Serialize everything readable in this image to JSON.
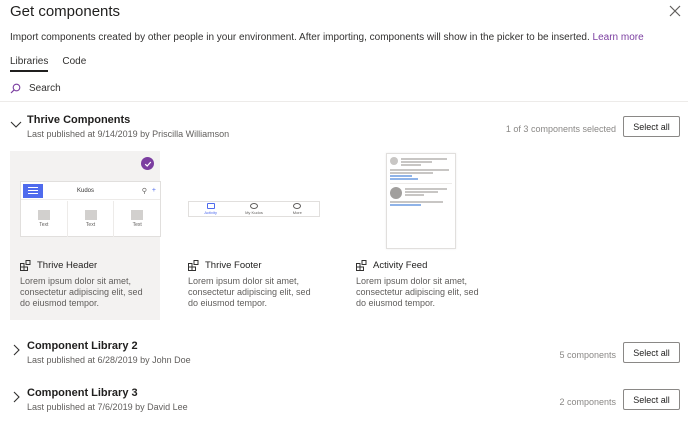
{
  "dialog": {
    "title": "Get components",
    "subtitle": "Import components created by other people in your environment. After importing, components will show in the picker to be inserted.",
    "learn_more": "Learn more",
    "close_icon": "close-icon"
  },
  "tabs": [
    {
      "label": "Libraries",
      "active": true
    },
    {
      "label": "Code",
      "active": false
    }
  ],
  "search": {
    "placeholder": "Search",
    "icon": "search-icon"
  },
  "libraries": [
    {
      "name": "Thrive Components",
      "meta": "Last published at 9/14/2019 by Priscilla Williamson",
      "count": "1 of 3 components selected",
      "select_all": "Select all",
      "expanded": true,
      "components": [
        {
          "name": "Thrive Header",
          "description": "Lorem ipsum dolor sit amet, consectetur adipiscing elit, sed do eiusmod tempor.",
          "selected": true,
          "preview": {
            "title": "Kudos",
            "tiles": [
              "Text",
              "Text",
              "Text"
            ]
          }
        },
        {
          "name": "Thrive Footer",
          "description": "Lorem ipsum dolor sit amet, consectetur adipiscing elit, sed do eiusmod tempor.",
          "selected": false,
          "preview": {
            "items": [
              "Activity",
              "My Kudos",
              "More"
            ]
          }
        },
        {
          "name": "Activity Feed",
          "description": "Lorem ipsum dolor sit amet, consectetur adipiscing elit, sed do eiusmod tempor.",
          "selected": false
        }
      ]
    },
    {
      "name": "Component Library 2",
      "meta": "Last published at 6/28/2019 by John Doe",
      "count": "5 components",
      "select_all": "Select all",
      "expanded": false
    },
    {
      "name": "Component Library 3",
      "meta": "Last published at 7/6/2019 by David Lee",
      "count": "2 components",
      "select_all": "Select all",
      "expanded": false
    }
  ],
  "colors": {
    "accent": "#7b3ea0",
    "brand_blue": "#4f6bed"
  }
}
